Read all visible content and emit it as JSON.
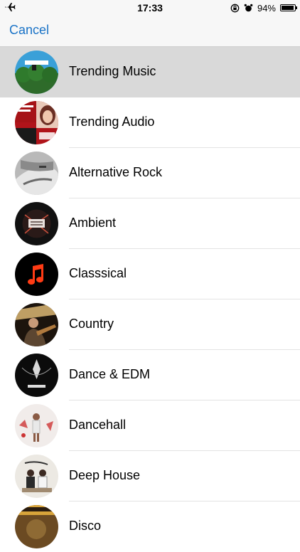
{
  "status_bar": {
    "time": "17:33",
    "battery": "94%",
    "battery_level": 0.94
  },
  "nav": {
    "cancel_label": "Cancel"
  },
  "genres": [
    {
      "label": "Trending Music",
      "icon": "broccoli-album-art",
      "selected": true
    },
    {
      "label": "Trending Audio",
      "icon": "crystal-chappell-art",
      "selected": false
    },
    {
      "label": "Alternative Rock",
      "icon": "hands-bw-art",
      "selected": false
    },
    {
      "label": "Ambient",
      "icon": "dark-album-art",
      "selected": false
    },
    {
      "label": "Classsical",
      "icon": "music-note-icon",
      "selected": false
    },
    {
      "label": "Country",
      "icon": "guitarist-art",
      "selected": false
    },
    {
      "label": "Dance & EDM",
      "icon": "illenium-art",
      "selected": false
    },
    {
      "label": "Dancehall",
      "icon": "dancehall-art",
      "selected": false
    },
    {
      "label": "Deep House",
      "icon": "duo-album-art",
      "selected": false
    },
    {
      "label": "Disco",
      "icon": "disco-album-art",
      "selected": false
    }
  ],
  "colors": {
    "accent": "#1a73c7",
    "selected_row": "#d9d9d9",
    "music_note": "#ff3b14"
  }
}
